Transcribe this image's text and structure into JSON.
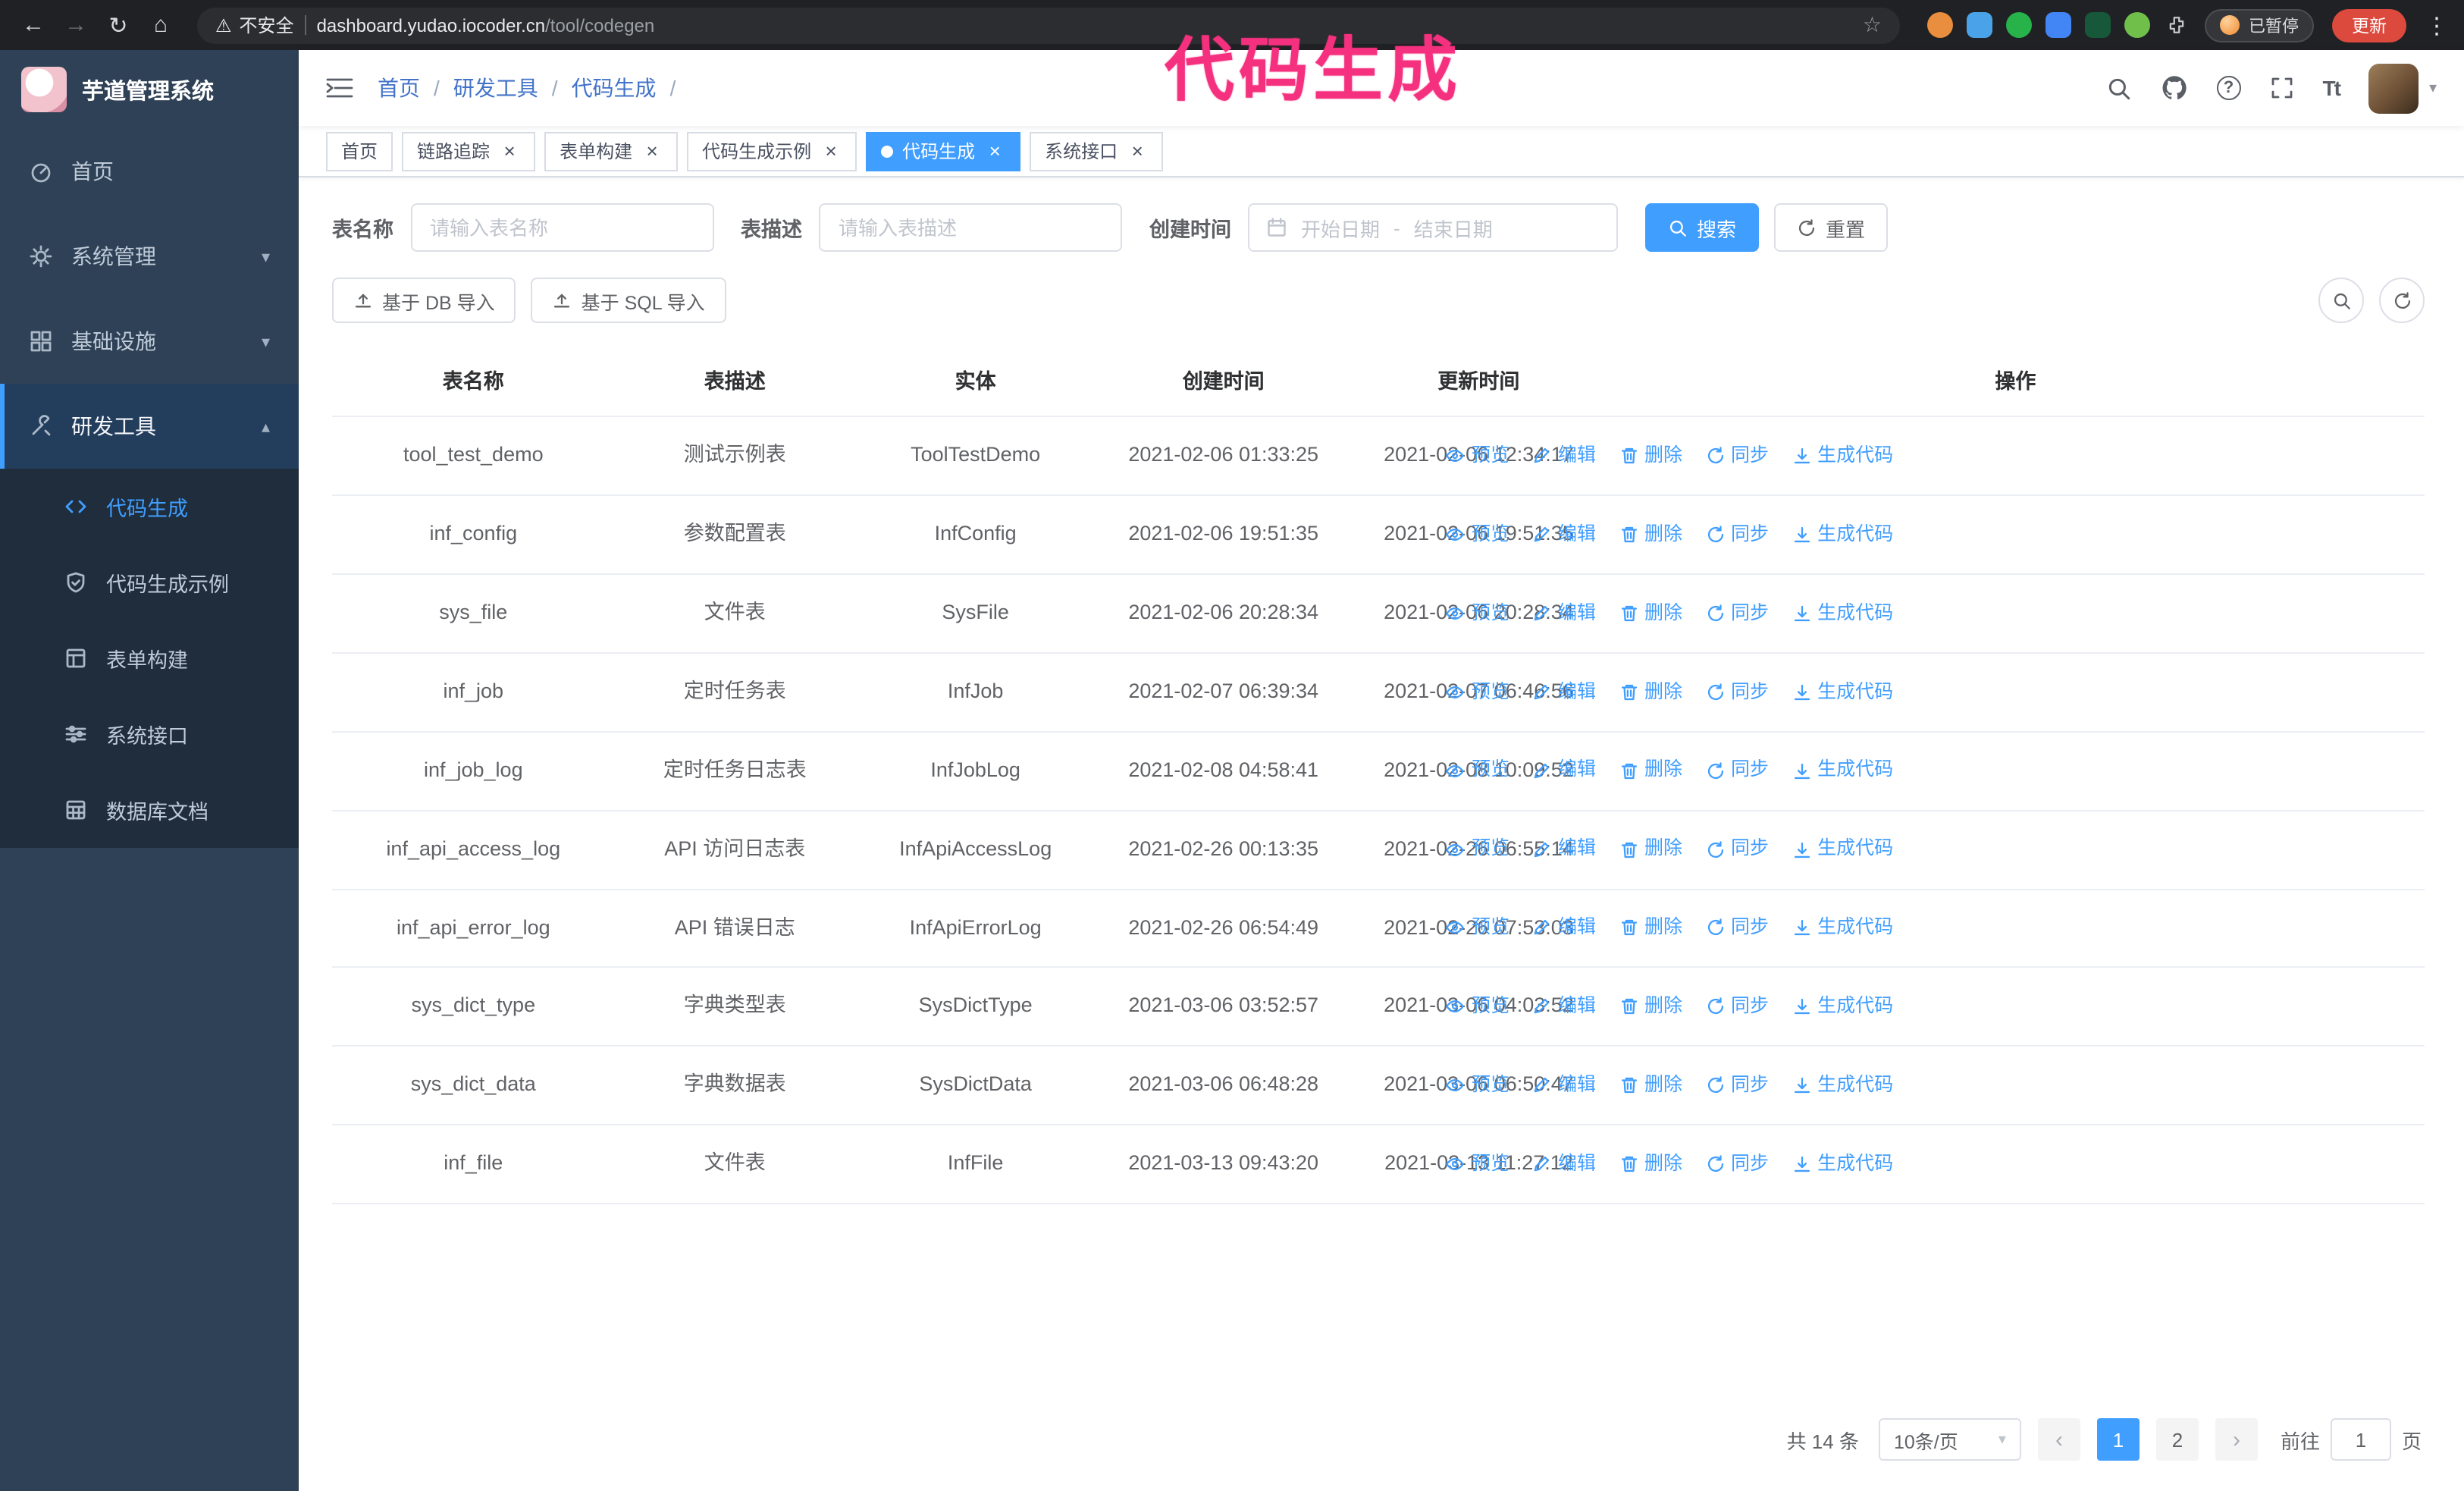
{
  "colors": {
    "accent": "#409eff",
    "sidebar_bg": "#2f4156",
    "submenu_bg": "#1f2d3d",
    "annotation": "#f5317f",
    "update_button_bg": "#dc4a3d"
  },
  "icons": {
    "back": "←",
    "forward": "→",
    "reload": "↻",
    "home": "⌂",
    "warning": "⚠",
    "star": "☆",
    "kebab": "⋮",
    "help": "?",
    "font_size": "Tt",
    "caret": "▾",
    "caret_up": "▴",
    "close": "×",
    "prev": "‹",
    "next": "›"
  },
  "annotation": {
    "text": "代码生成"
  },
  "browser": {
    "security_label": "不安全",
    "url_host": "dashboard.yudao.iocoder.cn",
    "url_path": "/tool/codegen",
    "paused_badge": "已暂停",
    "update_button": "更新"
  },
  "sidebar": {
    "logo_title": "芋道管理系统",
    "items": {
      "home": "首页",
      "system": "系统管理",
      "infra": "基础设施",
      "devtools": "研发工具"
    },
    "sub_items": {
      "codegen": "代码生成",
      "codegen_example": "代码生成示例",
      "form_builder": "表单构建",
      "system_api": "系统接口",
      "db_doc": "数据库文档"
    }
  },
  "header": {
    "breadcrumb": [
      "首页",
      "研发工具",
      "代码生成"
    ],
    "separator": "/"
  },
  "tabs": [
    {
      "label": "首页",
      "pinned": true
    },
    {
      "label": "链路追踪"
    },
    {
      "label": "表单构建"
    },
    {
      "label": "代码生成示例"
    },
    {
      "label": "代码生成",
      "active": true
    },
    {
      "label": "系统接口"
    }
  ],
  "filters": {
    "table_name_label": "表名称",
    "table_name_placeholder": "请输入表名称",
    "table_desc_label": "表描述",
    "table_desc_placeholder": "请输入表描述",
    "create_time_label": "创建时间",
    "date_start_placeholder": "开始日期",
    "date_separator": "-",
    "date_end_placeholder": "结束日期",
    "search_button": "搜索",
    "reset_button": "重置"
  },
  "toolbar": {
    "import_db": "基于 DB 导入",
    "import_sql": "基于 SQL 导入"
  },
  "table": {
    "columns": [
      "表名称",
      "表描述",
      "实体",
      "创建时间",
      "更新时间",
      "操作"
    ],
    "actions": [
      "预览",
      "编辑",
      "删除",
      "同步",
      "生成代码"
    ],
    "rows": [
      {
        "name": "tool_test_demo",
        "desc": "测试示例表",
        "entity": "ToolTestDemo",
        "created": "2021-02-06 01:33:25",
        "updated": "2021-02-06 12:34:17"
      },
      {
        "name": "inf_config",
        "desc": "参数配置表",
        "entity": "InfConfig",
        "created": "2021-02-06 19:51:35",
        "updated": "2021-02-06 19:51:35"
      },
      {
        "name": "sys_file",
        "desc": "文件表",
        "entity": "SysFile",
        "created": "2021-02-06 20:28:34",
        "updated": "2021-02-06 20:28:34"
      },
      {
        "name": "inf_job",
        "desc": "定时任务表",
        "entity": "InfJob",
        "created": "2021-02-07 06:39:34",
        "updated": "2021-02-07 06:46:56"
      },
      {
        "name": "inf_job_log",
        "desc": "定时任务日志表",
        "entity": "InfJobLog",
        "created": "2021-02-08 04:58:41",
        "updated": "2021-02-08 10:09:52"
      },
      {
        "name": "inf_api_access_log",
        "desc": "API 访问日志表",
        "entity": "InfApiAccessLog",
        "created": "2021-02-26 00:13:35",
        "updated": "2021-02-26 06:55:14"
      },
      {
        "name": "inf_api_error_log",
        "desc": "API 错误日志",
        "entity": "InfApiErrorLog",
        "created": "2021-02-26 06:54:49",
        "updated": "2021-02-26 07:53:03"
      },
      {
        "name": "sys_dict_type",
        "desc": "字典类型表",
        "entity": "SysDictType",
        "created": "2021-03-06 03:52:57",
        "updated": "2021-03-06 04:03:52"
      },
      {
        "name": "sys_dict_data",
        "desc": "字典数据表",
        "entity": "SysDictData",
        "created": "2021-03-06 06:48:28",
        "updated": "2021-03-06 06:50:47"
      },
      {
        "name": "inf_file",
        "desc": "文件表",
        "entity": "InfFile",
        "created": "2021-03-13 09:43:20",
        "updated": "2021-03-13 11:27:12"
      }
    ]
  },
  "pagination": {
    "total": "共 14 条",
    "page_size": "10条/页",
    "pages": [
      {
        "label": "1",
        "current": true
      },
      {
        "label": "2"
      }
    ],
    "goto_label": "前往",
    "goto_value": "1",
    "goto_unit": "页"
  }
}
